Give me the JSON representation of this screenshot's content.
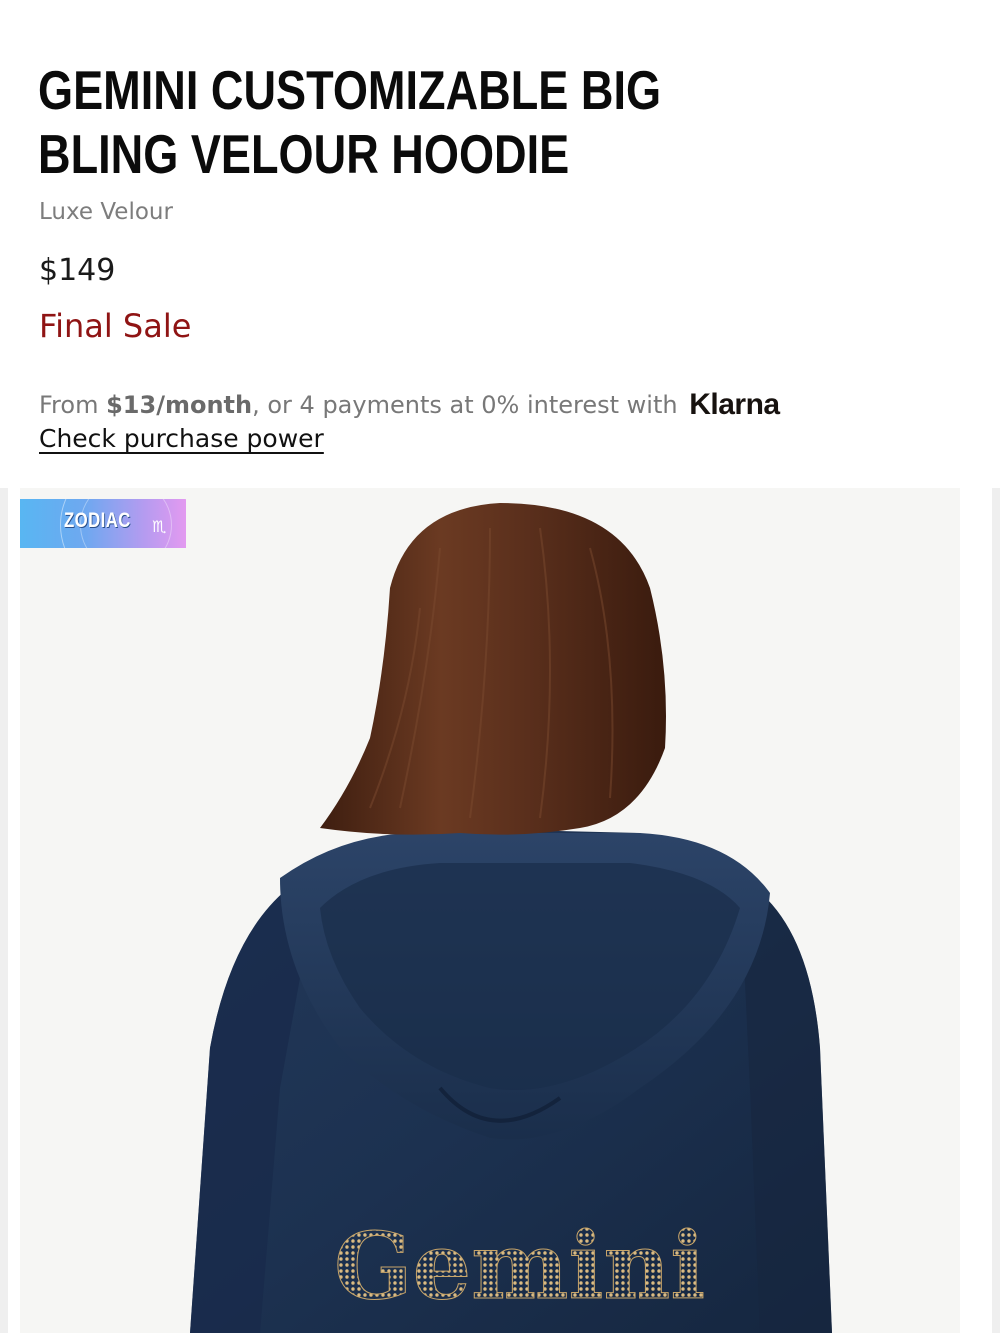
{
  "product": {
    "title": "GEMINI CUSTOMIZABLE BIG BLING VELOUR HOODIE",
    "collection": "Luxe Velour",
    "price": "$149",
    "sale_label": "Final Sale"
  },
  "financing": {
    "prefix": "From ",
    "monthly": "$13/month",
    "middle": ", or 4 payments at 0% interest with",
    "provider": "Klarna",
    "link_label": "Check purchase power"
  },
  "image": {
    "badge_text": "ZODIAC",
    "badge_symbol": "♏",
    "embroidery_text": "Gemini"
  },
  "colors": {
    "sale": "#8f1414",
    "velour": "#1d3350",
    "hair": "#5a2f1c",
    "badge_gradient": [
      "#58b6f2",
      "#e39af0"
    ]
  }
}
